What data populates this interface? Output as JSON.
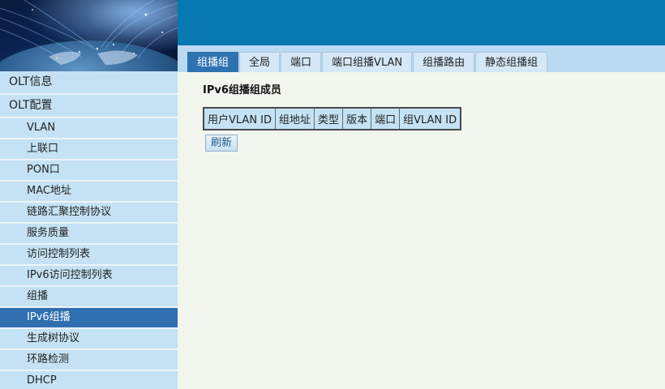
{
  "tabs": [
    {
      "label": "组播组",
      "active": true
    },
    {
      "label": "全局",
      "active": false
    },
    {
      "label": "端口",
      "active": false
    },
    {
      "label": "端口组播VLAN",
      "active": false
    },
    {
      "label": "组播路由",
      "active": false
    },
    {
      "label": "静态组播组",
      "active": false
    }
  ],
  "sidebar": {
    "items": [
      {
        "label": "OLT信息",
        "level": "top"
      },
      {
        "label": "OLT配置",
        "level": "top"
      },
      {
        "label": "VLAN",
        "level": "sub"
      },
      {
        "label": "上联口",
        "level": "sub"
      },
      {
        "label": "PON口",
        "level": "sub"
      },
      {
        "label": "MAC地址",
        "level": "sub"
      },
      {
        "label": "链路汇聚控制协议",
        "level": "sub"
      },
      {
        "label": "服务质量",
        "level": "sub"
      },
      {
        "label": "访问控制列表",
        "level": "sub"
      },
      {
        "label": "IPv6访问控制列表",
        "level": "sub"
      },
      {
        "label": "组播",
        "level": "sub"
      },
      {
        "label": "IPv6组播",
        "level": "sub",
        "active": true
      },
      {
        "label": "生成树协议",
        "level": "sub"
      },
      {
        "label": "环路检测",
        "level": "sub"
      },
      {
        "label": "DHCP",
        "level": "sub"
      }
    ]
  },
  "main": {
    "heading": "IPv6组播组成员",
    "columns": [
      "用户VLAN ID",
      "组地址",
      "类型",
      "版本",
      "端口",
      "组VLAN ID"
    ],
    "refresh_label": "刷新"
  },
  "colors": {
    "topbar": "#0679b3",
    "tab_active": "#2e72b2",
    "sidebar_item": "#c4e2f4",
    "sidebar_active": "#2f6fb0"
  }
}
